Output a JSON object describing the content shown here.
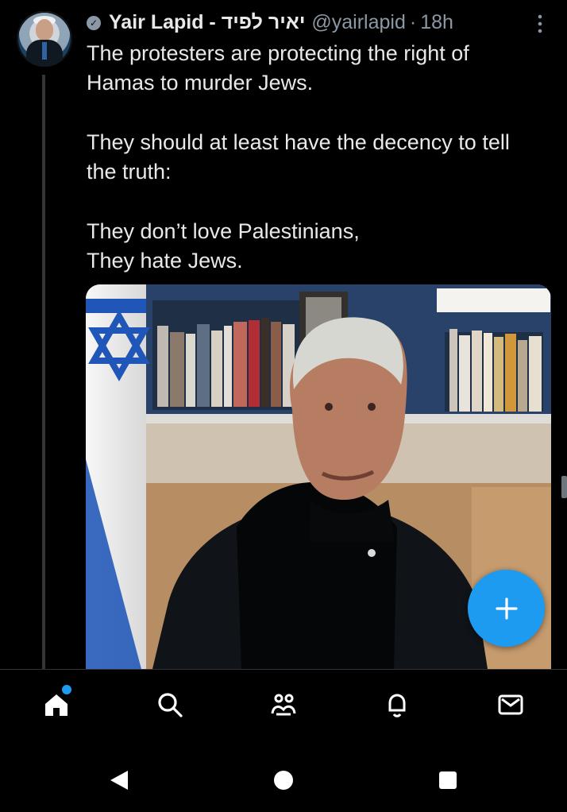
{
  "post": {
    "author_name": "Yair Lapid - יאיר לפיד",
    "handle": "@yairlapid",
    "separator": "·",
    "time": "18h",
    "text": {
      "line_1": "The protesters are protecting the right of",
      "line_2": "Hamas to murder Jews.",
      "line_3": "They should at least have the decency to tell",
      "line_4": "the truth:",
      "line_5": "They don’t love Palestinians,",
      "line_6": "They hate Jews."
    }
  },
  "icons": {
    "verified": "verified-badge",
    "more": "more-vertical-icon",
    "compose": "plus-icon",
    "home": "home-icon",
    "search": "search-icon",
    "communities": "people-icon",
    "notifications": "bell-icon",
    "messages": "mail-icon",
    "back": "back-icon",
    "home_nav": "home-nav-icon",
    "recents": "recents-icon"
  },
  "colors": {
    "background": "#000000",
    "text": "#e7e9ea",
    "secondary": "#8b98a5",
    "accent": "#1d9bf0"
  }
}
